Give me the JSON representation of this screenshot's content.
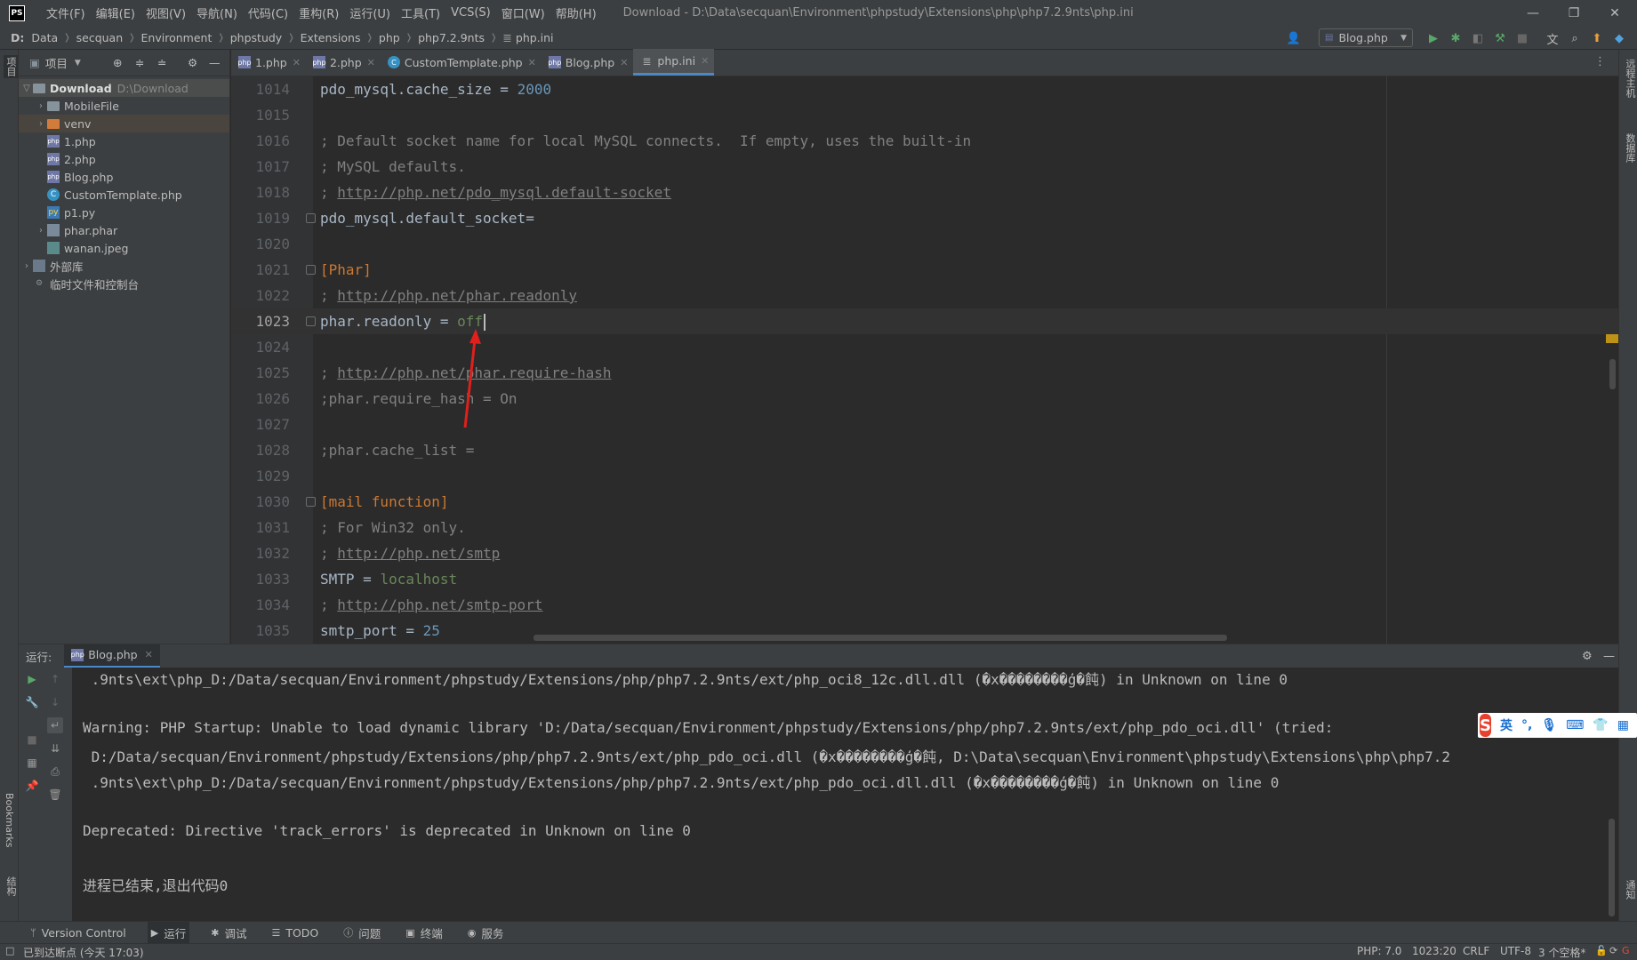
{
  "app": {
    "logo": "PS",
    "window_title": "Download - D:\\Data\\secquan\\Environment\\phpstudy\\Extensions\\php\\php7.2.9nts\\php.ini"
  },
  "menu": [
    "文件(F)",
    "编辑(E)",
    "视图(V)",
    "导航(N)",
    "代码(C)",
    "重构(R)",
    "运行(U)",
    "工具(T)",
    "VCS(S)",
    "窗口(W)",
    "帮助(H)"
  ],
  "breadcrumbs": [
    "D:",
    "Data",
    "secquan",
    "Environment",
    "phpstudy",
    "Extensions",
    "php",
    "php7.2.9nts",
    "php.ini"
  ],
  "run_config": "Blog.php",
  "project": {
    "header": "项目",
    "root": {
      "name": "Download",
      "path": "D:\\Download"
    },
    "items": [
      {
        "label": "MobileFile",
        "type": "folder"
      },
      {
        "label": "venv",
        "type": "folder-excluded"
      },
      {
        "label": "1.php",
        "type": "php"
      },
      {
        "label": "2.php",
        "type": "php"
      },
      {
        "label": "Blog.php",
        "type": "php"
      },
      {
        "label": "CustomTemplate.php",
        "type": "class"
      },
      {
        "label": "p1.py",
        "type": "python"
      },
      {
        "label": "phar.phar",
        "type": "phar"
      },
      {
        "label": "wanan.jpeg",
        "type": "image"
      }
    ],
    "external_libs": "外部库",
    "scratches": "临时文件和控制台"
  },
  "tabs": [
    "1.php",
    "2.php",
    "CustomTemplate.php",
    "Blog.php",
    "php.ini"
  ],
  "editor": {
    "lines": [
      {
        "n": "1014",
        "text": "pdo_mysql.cache_size = 2000"
      },
      {
        "n": "1015",
        "text": ""
      },
      {
        "n": "1016",
        "text": "; Default socket name for local MySQL connects.  If empty, uses the built-in"
      },
      {
        "n": "1017",
        "text": "; MySQL defaults."
      },
      {
        "n": "1018",
        "text": "; http://php.net/pdo_mysql.default-socket"
      },
      {
        "n": "1019",
        "text": "pdo_mysql.default_socket="
      },
      {
        "n": "1020",
        "text": ""
      },
      {
        "n": "1021",
        "text": "[Phar]"
      },
      {
        "n": "1022",
        "text": "; http://php.net/phar.readonly"
      },
      {
        "n": "1023",
        "text": "phar.readonly = off"
      },
      {
        "n": "1024",
        "text": ""
      },
      {
        "n": "1025",
        "text": "; http://php.net/phar.require-hash"
      },
      {
        "n": "1026",
        "text": ";phar.require_hash = On"
      },
      {
        "n": "1027",
        "text": ""
      },
      {
        "n": "1028",
        "text": ";phar.cache_list ="
      },
      {
        "n": "1029",
        "text": ""
      },
      {
        "n": "1030",
        "text": "[mail function]"
      },
      {
        "n": "1031",
        "text": "; For Win32 only."
      },
      {
        "n": "1032",
        "text": "; http://php.net/smtp"
      },
      {
        "n": "1033",
        "text": "SMTP = localhost"
      },
      {
        "n": "1034",
        "text": "; http://php.net/smtp-port"
      },
      {
        "n": "1035",
        "text": "smtp_port = 25"
      }
    ]
  },
  "run": {
    "label": "运行:",
    "tab": "Blog.php",
    "output": [
      " .9nts\\ext\\php_D:/Data/secquan/Environment/phpstudy/Extensions/php/php7.2.9nts/ext/php_oci8_12c.dll.dll (�x��������ģ�飩) in Unknown on line 0",
      "",
      "Warning: PHP Startup: Unable to load dynamic library 'D:/Data/secquan/Environment/phpstudy/Extensions/php/php7.2.9nts/ext/php_pdo_oci.dll' (tried:",
      " D:/Data/secquan/Environment/phpstudy/Extensions/php/php7.2.9nts/ext/php_pdo_oci.dll (�x��������ģ�飩, D:\\Data\\secquan\\Environment\\phpstudy\\Extensions\\php\\php7.2",
      " .9nts\\ext\\php_D:/Data/secquan/Environment/phpstudy/Extensions/php/php7.2.9nts/ext/php_pdo_oci.dll.dll (�x��������ģ�飩) in Unknown on line 0",
      "",
      "Deprecated: Directive 'track_errors' is deprecated in Unknown on line 0",
      "",
      "进程已结束,退出代码0"
    ]
  },
  "tool_windows": [
    "Version Control",
    "运行",
    "调试",
    "TODO",
    "问题",
    "终端",
    "服务"
  ],
  "side_labels": {
    "left_top": "项目",
    "left_bookmarks": "Bookmarks",
    "left_structure": "结构",
    "right_remote": "远程主机",
    "right_db": "数据库",
    "right_notify": "通知"
  },
  "status": {
    "message": "已到达断点 (今天 17:03)",
    "php": "PHP: 7.0",
    "position": "1023:20",
    "line_sep": "CRLF",
    "encoding": "UTF-8",
    "indent": "3 个空格*"
  },
  "ime": {
    "logo": "S",
    "mode": "英",
    "punct": "°,"
  }
}
